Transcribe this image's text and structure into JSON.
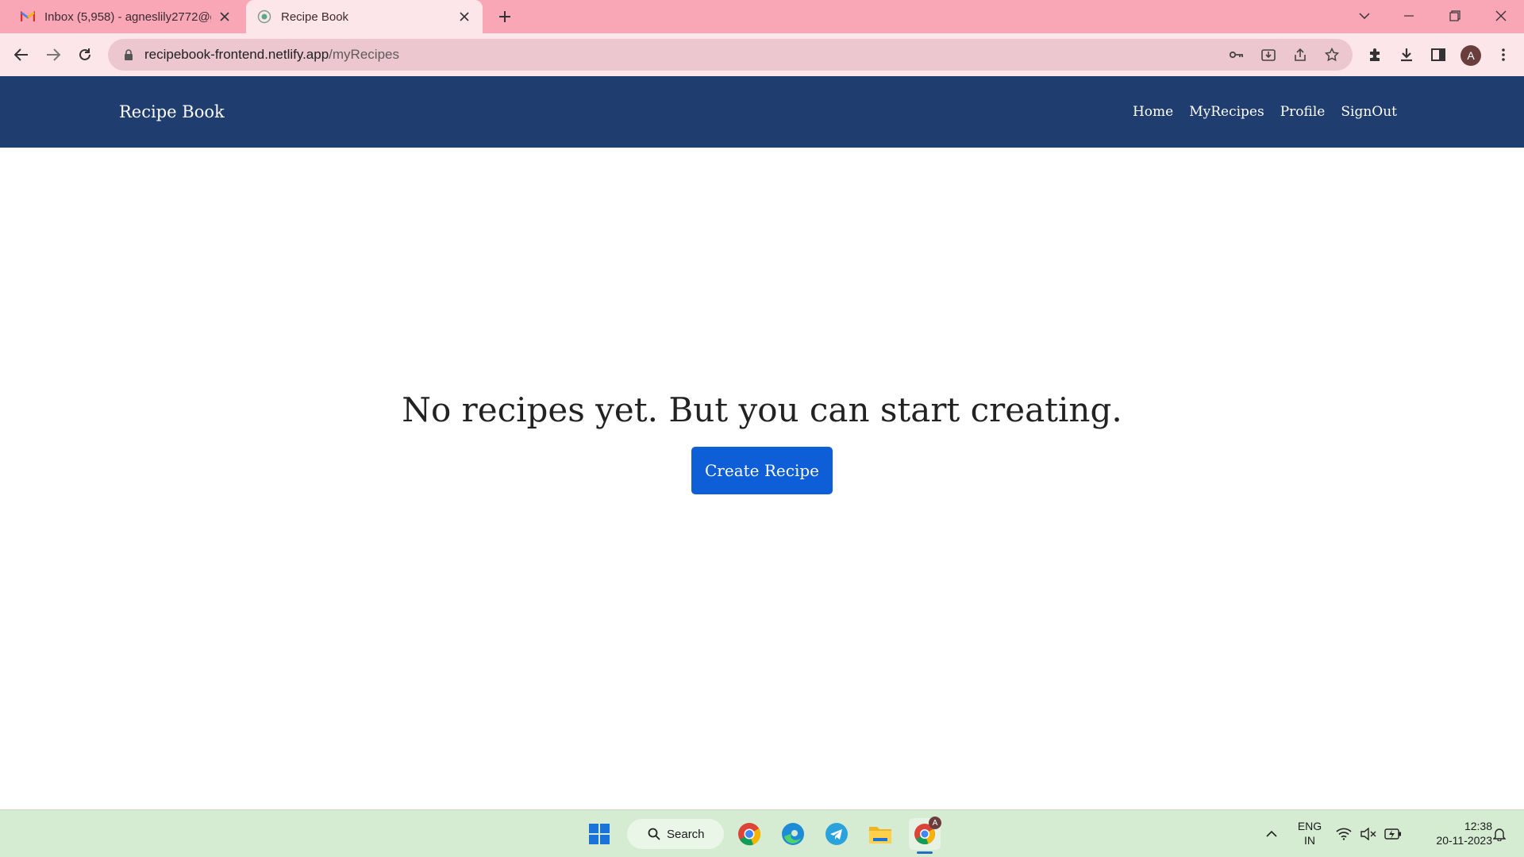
{
  "browser": {
    "tabs": [
      {
        "title": "Inbox (5,958) - agneslily2772@g",
        "favicon": "gmail-icon",
        "active": false
      },
      {
        "title": "Recipe Book",
        "favicon": "site-globe-icon",
        "active": true
      }
    ],
    "address": {
      "domain": "recipebook-frontend.netlify.app",
      "path": "/myRecipes"
    },
    "profile_initial": "A"
  },
  "site": {
    "brand": "Recipe Book",
    "nav": [
      "Home",
      "MyRecipes",
      "Profile",
      "SignOut"
    ],
    "empty_message": "No recipes yet. But you can start creating.",
    "create_button": "Create Recipe"
  },
  "taskbar": {
    "search_label": "Search",
    "language": "ENG",
    "region": "IN",
    "time": "12:38",
    "date": "20-11-2023",
    "apps": [
      "windows-start-icon",
      "chrome-icon",
      "edge-icon",
      "telegram-icon",
      "file-explorer-icon",
      "chrome-profile-icon"
    ],
    "chrome_badge": "A"
  },
  "colors": {
    "tab_strip": "#f9a7b7",
    "toolbar": "#fde6ea",
    "navbar": "#1f3d6e",
    "primary_button": "#0d5ed7",
    "taskbar": "#d5ecd2"
  }
}
